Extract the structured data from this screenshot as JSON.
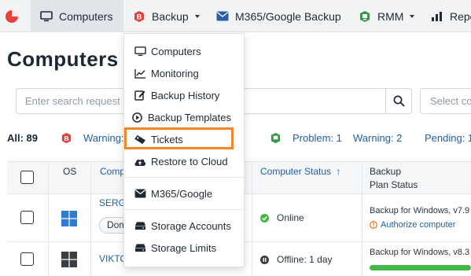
{
  "topnav": {
    "items": [
      {
        "label": "Computers",
        "icon": "monitor-icon",
        "active": true
      },
      {
        "label": "Backup",
        "icon": "backup-shield-icon",
        "dropdown": true
      },
      {
        "label": "M365/Google Backup",
        "icon": "envelope-icon"
      },
      {
        "label": "RMM",
        "icon": "rmm-icon",
        "dropdown": true
      },
      {
        "label": "Repo",
        "icon": "report-chart-icon"
      }
    ]
  },
  "page": {
    "title": "Computers"
  },
  "search": {
    "placeholder": "Enter search request",
    "select_placeholder": "Select co"
  },
  "filters": {
    "all": "All: 89",
    "warning_left": "Warning:",
    "problem": "Problem: 1",
    "warning": "Warning: 2",
    "pending": "Pending: 1"
  },
  "table": {
    "headers": {
      "os": "OS",
      "computer": "Compu",
      "status": "Computer Status",
      "sort_arrow": "↑",
      "backup": "Backup",
      "plan_status": "Plan Status"
    },
    "rows": [
      {
        "name": "SERGE",
        "tag": "Dom",
        "status": "Online",
        "backup_plan": "Backup for Windows, v7.9",
        "backup_action": "Authorize computer"
      },
      {
        "name": "VIKTO",
        "status": "Offline: 1 day",
        "backup_plan": "Backup for Windows, v8.3",
        "progress": 1.0
      }
    ]
  },
  "backup_menu": {
    "items": [
      {
        "label": "Computers",
        "icon": "monitor-icon"
      },
      {
        "label": "Monitoring",
        "icon": "monitoring-chart-icon"
      },
      {
        "label": "Backup History",
        "icon": "history-edit-icon"
      },
      {
        "label": "Backup Templates",
        "icon": "play-circle-icon"
      },
      {
        "label": "Tickets",
        "icon": "ticket-icon",
        "highlighted": true
      },
      {
        "label": "Restore to Cloud",
        "icon": "cloud-upload-icon"
      },
      {
        "label": "M365/Google",
        "icon": "envelope-icon"
      },
      {
        "label": "Storage Accounts",
        "icon": "storage-drive-icon"
      },
      {
        "label": "Storage Limits",
        "icon": "storage-drive-icon"
      }
    ]
  },
  "colors": {
    "brand_red": "#e8413a",
    "accent_orange": "#f2862a",
    "link_blue": "#1f5fa3",
    "status_green": "#44b847",
    "warning_orange": "#ee7a22"
  }
}
